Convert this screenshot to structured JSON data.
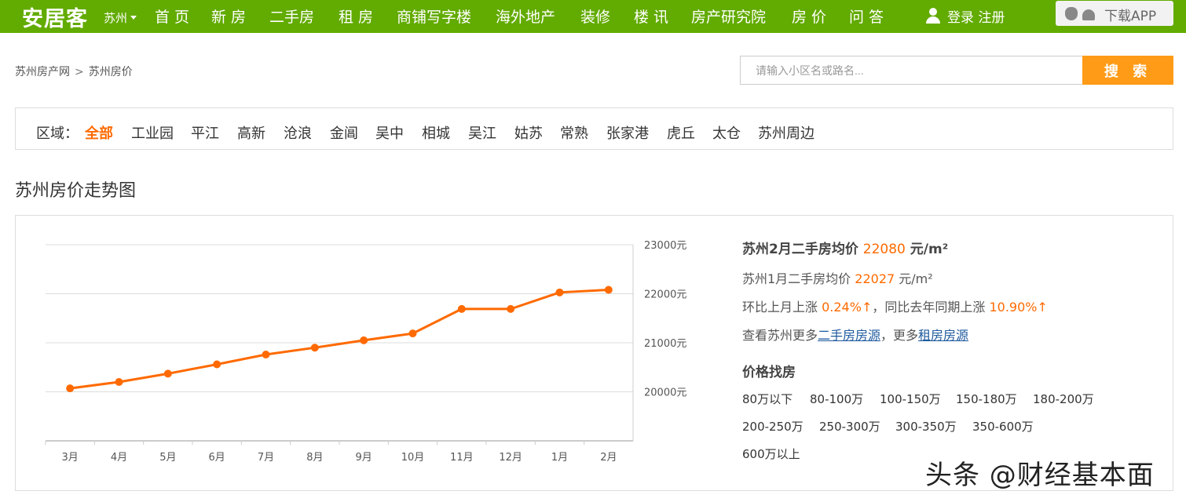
{
  "topbar": {
    "logo": "安居客",
    "city": "苏州",
    "nav": [
      "首 页",
      "新 房",
      "二手房",
      "租 房",
      "商铺写字楼",
      "海外地产",
      "装修",
      "楼 讯",
      "房产研究院",
      "房 价",
      "问 答"
    ],
    "login": "登录 注册",
    "app_button": "下载APP",
    "colors": {
      "bar": "#62ab00",
      "accent": "#ff6a00",
      "search_button": "#ff9b16"
    }
  },
  "breadcrumb": {
    "home": "苏州房产网",
    "separator": ">",
    "current": "苏州房价"
  },
  "search": {
    "placeholder": "请输入小区名或路名...",
    "button": "搜 索"
  },
  "filter": {
    "label": "区域：",
    "items": [
      "全部",
      "工业园",
      "平江",
      "高新",
      "沧浪",
      "金阊",
      "吴中",
      "相城",
      "吴江",
      "姑苏",
      "常熟",
      "张家港",
      "虎丘",
      "太仓",
      "苏州周边"
    ],
    "active": "全部"
  },
  "section_title": "苏州房价走势图",
  "chart_data": {
    "type": "line",
    "categories": [
      "3月",
      "4月",
      "5月",
      "6月",
      "7月",
      "8月",
      "9月",
      "10月",
      "11月",
      "12月",
      "1月",
      "2月"
    ],
    "values": [
      20070,
      20200,
      20370,
      20560,
      20760,
      20900,
      21050,
      21190,
      21690,
      21690,
      22027,
      22080
    ],
    "y_ticks": [
      "23000元",
      "22000元",
      "21000元",
      "20000元"
    ],
    "ylim": [
      19000,
      23000
    ],
    "grid": true,
    "line_color": "#ff6a00"
  },
  "info": {
    "main_prefix": "苏州2月二手房均价",
    "main_value": "22080",
    "main_unit": "元/m²",
    "prev_prefix": "苏州1月二手房均价",
    "prev_value": "22027",
    "prev_unit": "元/m²",
    "mom_prefix": "环比上月上涨",
    "mom_value": "0.24%",
    "arrow": "↑",
    "yoy_prefix": "，同比去年同期上涨",
    "yoy_value": "10.90%",
    "more_prefix": "查看苏州更多",
    "more_link1": "二手房房源",
    "more_mid": "，更多",
    "more_link2": "租房房源"
  },
  "price_filter": {
    "title": "价格找房",
    "items": [
      "80万以下",
      "80-100万",
      "100-150万",
      "150-180万",
      "180-200万",
      "200-250万",
      "250-300万",
      "300-350万",
      "350-600万",
      "600万以上"
    ]
  },
  "watermark": "头条 @财经基本面"
}
